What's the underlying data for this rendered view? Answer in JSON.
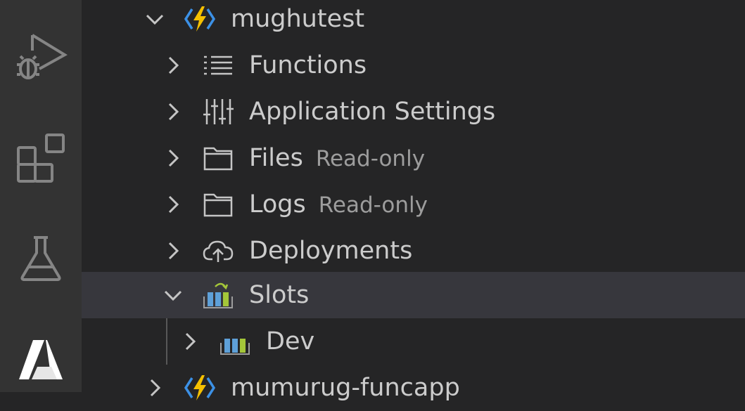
{
  "tree": {
    "app": {
      "label": "mughutest",
      "icon": "function-app-icon",
      "expanded": true
    },
    "children": [
      {
        "label": "Functions",
        "description": "",
        "icon": "list-icon"
      },
      {
        "label": "Application Settings",
        "description": "",
        "icon": "settings-sliders-icon"
      },
      {
        "label": "Files",
        "description": "Read-only",
        "icon": "folder-icon"
      },
      {
        "label": "Logs",
        "description": "Read-only",
        "icon": "folder-icon"
      },
      {
        "label": "Deployments",
        "description": "",
        "icon": "cloud-upload-icon"
      },
      {
        "label": "Slots",
        "description": "",
        "icon": "slots-icon",
        "expanded": true,
        "selected": true
      }
    ],
    "slot_children": [
      {
        "label": "Dev",
        "icon": "slot-icon"
      }
    ],
    "next_app": {
      "label": "mumurug-funcapp",
      "icon": "function-app-icon"
    }
  },
  "activity_bar": [
    "run-debug-icon",
    "extensions-icon",
    "testing-icon",
    "azure-icon"
  ],
  "colors": {
    "sidebar_bg": "#252526",
    "activity_bg": "#333333",
    "selected_bg": "#37373d",
    "text": "#cccccc",
    "description": "#9d9d9d",
    "bolt": "#f5c000",
    "bolt_brackets": "#3c91e6"
  }
}
